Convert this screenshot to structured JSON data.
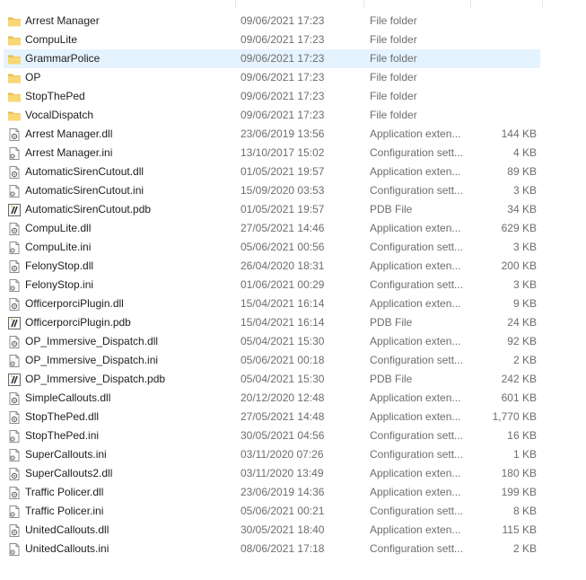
{
  "files": [
    {
      "name": "Arrest Manager",
      "date": "09/06/2021 17:23",
      "type": "File folder",
      "size": "",
      "icon": "folder-icon"
    },
    {
      "name": "CompuLite",
      "date": "09/06/2021 17:23",
      "type": "File folder",
      "size": "",
      "icon": "folder-icon"
    },
    {
      "name": "GrammarPolice",
      "date": "09/06/2021 17:23",
      "type": "File folder",
      "size": "",
      "icon": "folder-icon",
      "selected": true
    },
    {
      "name": "OP",
      "date": "09/06/2021 17:23",
      "type": "File folder",
      "size": "",
      "icon": "folder-icon"
    },
    {
      "name": "StopThePed",
      "date": "09/06/2021 17:23",
      "type": "File folder",
      "size": "",
      "icon": "folder-icon"
    },
    {
      "name": "VocalDispatch",
      "date": "09/06/2021 17:23",
      "type": "File folder",
      "size": "",
      "icon": "folder-icon"
    },
    {
      "name": "Arrest Manager.dll",
      "date": "23/06/2019 13:56",
      "type": "Application exten...",
      "size": "144 KB",
      "icon": "dll-file-icon"
    },
    {
      "name": "Arrest Manager.ini",
      "date": "13/10/2017 15:02",
      "type": "Configuration sett...",
      "size": "4 KB",
      "icon": "ini-file-icon"
    },
    {
      "name": "AutomaticSirenCutout.dll",
      "date": "01/05/2021 19:57",
      "type": "Application exten...",
      "size": "89 KB",
      "icon": "dll-file-icon"
    },
    {
      "name": "AutomaticSirenCutout.ini",
      "date": "15/09/2020 03:53",
      "type": "Configuration sett...",
      "size": "3 KB",
      "icon": "ini-file-icon"
    },
    {
      "name": "AutomaticSirenCutout.pdb",
      "date": "01/05/2021 19:57",
      "type": "PDB File",
      "size": "34 KB",
      "icon": "pdb-file-icon"
    },
    {
      "name": "CompuLite.dll",
      "date": "27/05/2021 14:46",
      "type": "Application exten...",
      "size": "629 KB",
      "icon": "dll-file-icon"
    },
    {
      "name": "CompuLite.ini",
      "date": "05/06/2021 00:56",
      "type": "Configuration sett...",
      "size": "3 KB",
      "icon": "ini-file-icon"
    },
    {
      "name": "FelonyStop.dll",
      "date": "26/04/2020 18:31",
      "type": "Application exten...",
      "size": "200 KB",
      "icon": "dll-file-icon"
    },
    {
      "name": "FelonyStop.ini",
      "date": "01/06/2021 00:29",
      "type": "Configuration sett...",
      "size": "3 KB",
      "icon": "ini-file-icon"
    },
    {
      "name": "OfficerporciPlugin.dll",
      "date": "15/04/2021 16:14",
      "type": "Application exten...",
      "size": "9 KB",
      "icon": "dll-file-icon"
    },
    {
      "name": "OfficerporciPlugin.pdb",
      "date": "15/04/2021 16:14",
      "type": "PDB File",
      "size": "24 KB",
      "icon": "pdb-file-icon"
    },
    {
      "name": "OP_Immersive_Dispatch.dll",
      "date": "05/04/2021 15:30",
      "type": "Application exten...",
      "size": "92 KB",
      "icon": "dll-file-icon"
    },
    {
      "name": "OP_Immersive_Dispatch.ini",
      "date": "05/06/2021 00:18",
      "type": "Configuration sett...",
      "size": "2 KB",
      "icon": "ini-file-icon"
    },
    {
      "name": "OP_Immersive_Dispatch.pdb",
      "date": "05/04/2021 15:30",
      "type": "PDB File",
      "size": "242 KB",
      "icon": "pdb-file-icon"
    },
    {
      "name": "SimpleCallouts.dll",
      "date": "20/12/2020 12:48",
      "type": "Application exten...",
      "size": "601 KB",
      "icon": "dll-file-icon"
    },
    {
      "name": "StopThePed.dll",
      "date": "27/05/2021 14:48",
      "type": "Application exten...",
      "size": "1,770 KB",
      "icon": "dll-file-icon"
    },
    {
      "name": "StopThePed.ini",
      "date": "30/05/2021 04:56",
      "type": "Configuration sett...",
      "size": "16 KB",
      "icon": "ini-file-icon"
    },
    {
      "name": "SuperCallouts.ini",
      "date": "03/11/2020 07:26",
      "type": "Configuration sett...",
      "size": "1 KB",
      "icon": "ini-file-icon"
    },
    {
      "name": "SuperCallouts2.dll",
      "date": "03/11/2020 13:49",
      "type": "Application exten...",
      "size": "180 KB",
      "icon": "dll-file-icon"
    },
    {
      "name": "Traffic Policer.dll",
      "date": "23/06/2019 14:36",
      "type": "Application exten...",
      "size": "199 KB",
      "icon": "dll-file-icon"
    },
    {
      "name": "Traffic Policer.ini",
      "date": "05/06/2021 00:21",
      "type": "Configuration sett...",
      "size": "8 KB",
      "icon": "ini-file-icon"
    },
    {
      "name": "UnitedCallouts.dll",
      "date": "30/05/2021 18:40",
      "type": "Application exten...",
      "size": "115 KB",
      "icon": "dll-file-icon"
    },
    {
      "name": "UnitedCallouts.ini",
      "date": "08/06/2021 17:18",
      "type": "Configuration sett...",
      "size": "2 KB",
      "icon": "ini-file-icon"
    }
  ],
  "colors": {
    "selection": "#e5f3ff",
    "folder": "#f8d775",
    "secondary_text": "#6d6d6d"
  }
}
